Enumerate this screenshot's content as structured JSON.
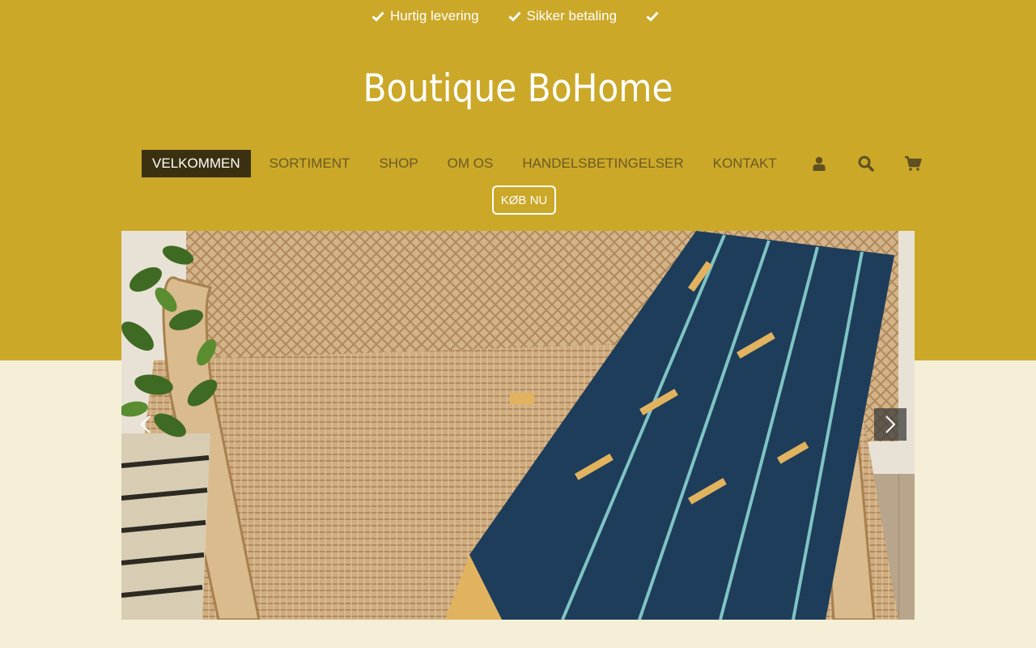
{
  "usp": {
    "items": [
      {
        "label": "Hurtig levering",
        "icon": "check-icon"
      },
      {
        "label": "Sikker betaling",
        "icon": "check-icon"
      },
      {
        "label": "",
        "icon": "check-icon"
      }
    ]
  },
  "site": {
    "title": "Boutique BoHome"
  },
  "nav": {
    "items": [
      {
        "label": "VELKOMMEN",
        "active": true
      },
      {
        "label": "SORTIMENT",
        "active": false
      },
      {
        "label": "SHOP",
        "active": false
      },
      {
        "label": "OM OS",
        "active": false
      },
      {
        "label": "HANDELSBETINGELSER",
        "active": false
      },
      {
        "label": "KONTAKT",
        "active": false
      }
    ],
    "icons": [
      "user-icon",
      "search-icon",
      "cart-icon"
    ],
    "buy_now_label": "KØB NU"
  },
  "slider": {
    "image": "wicker-chair-with-blue-striped-textile-photo",
    "prev_icon": "chevron-left-icon",
    "next_icon": "chevron-right-icon"
  },
  "colors": {
    "accent": "#cba828",
    "page_background": "#f5efd8",
    "nav_active_bg": "#3b3110",
    "nav_text": "#6b5a24",
    "header_text": "#ffffff"
  }
}
